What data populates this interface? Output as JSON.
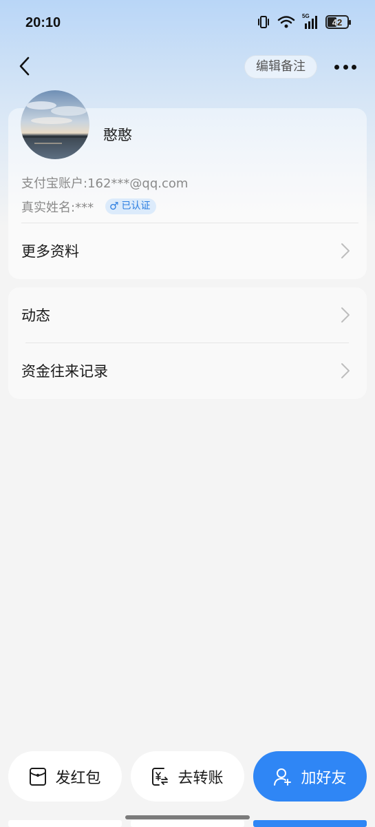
{
  "status_bar": {
    "time": "20:10",
    "network": "5G",
    "battery": "42"
  },
  "header": {
    "edit_note_label": "编辑备注"
  },
  "profile": {
    "nickname": "憨憨",
    "account": "支付宝账户:162***@qq.com",
    "real_name": "真实姓名:***",
    "verified_label": "已认证",
    "gender_symbol": "♂"
  },
  "menu": {
    "more_info": "更多资料",
    "moments": "动态",
    "transactions": "资金往来记录"
  },
  "actions": {
    "red_packet": "发红包",
    "transfer": "去转账",
    "add_friend": "加好友"
  },
  "colors": {
    "accent": "#2f86f5",
    "verified_bg": "#dcebfb",
    "verified_text": "#2b7de0"
  }
}
